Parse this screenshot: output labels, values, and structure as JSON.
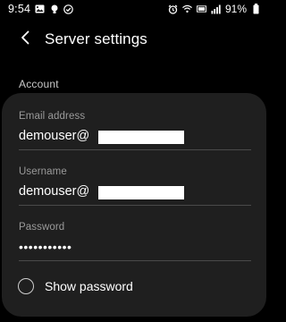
{
  "status_bar": {
    "time": "9:54",
    "left_icons": [
      "gallery-icon",
      "bulb-icon",
      "check-circle-icon"
    ],
    "right_icons": [
      "alarm-icon",
      "wifi-icon",
      "lte-icon",
      "signal-icon",
      "battery-icon"
    ],
    "battery_percent": "91%"
  },
  "app_bar": {
    "title": "Server settings"
  },
  "section": {
    "title": "Account"
  },
  "fields": {
    "email": {
      "label": "Email address",
      "value": "demouser@"
    },
    "username": {
      "label": "Username",
      "value": "demouser@"
    },
    "password": {
      "label": "Password",
      "value": "•••••••••••"
    }
  },
  "show_password": {
    "label": "Show password",
    "checked": false
  },
  "colors": {
    "background": "#000000",
    "card": "#1f1f1f",
    "label": "#9a9a9a",
    "divider": "#4a4a4a"
  }
}
